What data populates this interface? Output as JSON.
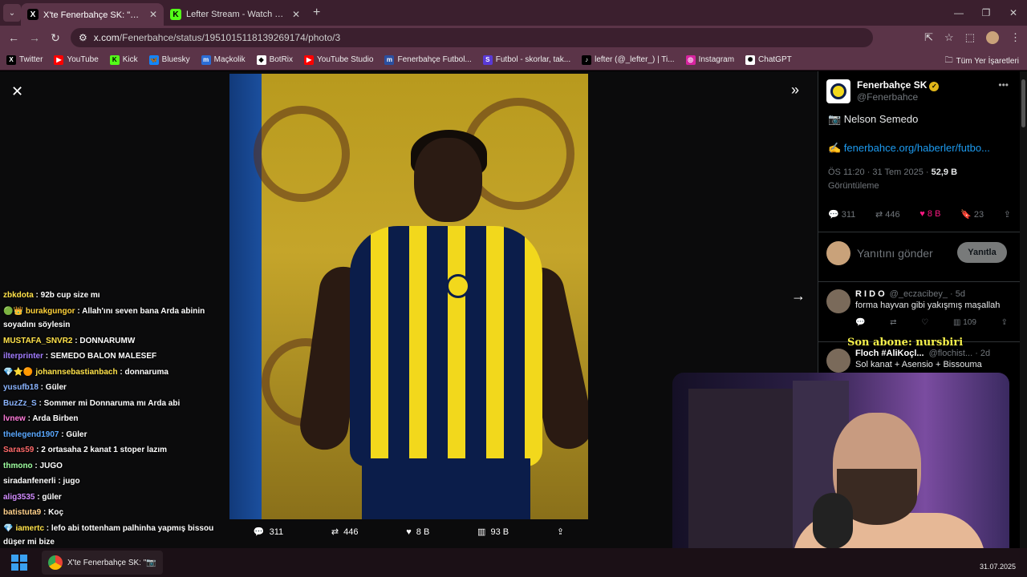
{
  "browser": {
    "tabs": [
      {
        "label": "X'te Fenerbahçe SK: \"📷 Nelson",
        "favicon": "x-logo-icon",
        "active": true
      },
      {
        "label": "Lefter Stream - Watch Live on K",
        "favicon": "kick-logo-icon",
        "active": false
      }
    ],
    "url_host": "x.com",
    "url_path": "/Fenerbahce/status/1951015118139269174/photo/3",
    "bookmarks": [
      {
        "label": "Twitter",
        "icon": "x-logo-icon"
      },
      {
        "label": "YouTube",
        "icon": "youtube-icon"
      },
      {
        "label": "Kick",
        "icon": "kick-logo-icon"
      },
      {
        "label": "Bluesky",
        "icon": "bluesky-icon"
      },
      {
        "label": "Maçkolik",
        "icon": "mackolik-icon"
      },
      {
        "label": "BotRix",
        "icon": "botrix-icon"
      },
      {
        "label": "YouTube Studio",
        "icon": "youtube-icon"
      },
      {
        "label": "Fenerbahçe Futbol...",
        "icon": "fenerbahce-icon"
      },
      {
        "label": "Futbol - skorlar, tak...",
        "icon": "futbol-icon"
      },
      {
        "label": "lefter (@_lefter_) | Ti...",
        "icon": "tiktok-icon"
      },
      {
        "label": "Instagram",
        "icon": "instagram-icon"
      },
      {
        "label": "ChatGPT",
        "icon": "chatgpt-icon"
      }
    ],
    "all_bookmarks": "Tüm Yer İşaretleri"
  },
  "photo_actions": {
    "replies": "311",
    "reposts": "446",
    "likes": "8 B",
    "views": "93 B"
  },
  "tweet": {
    "author_name": "Fenerbahçe SK",
    "author_handle": "@Fenerbahce",
    "text": "📷 Nelson Semedo",
    "link": "✍️ fenerbahce.org/haberler/futbo...",
    "time": "ÖS 11:20 · 31 Tem 2025 · ",
    "views": "52,9 B",
    "views_label": "Görüntüleme",
    "replies": "311",
    "reposts": "446",
    "likes": "8 B",
    "bookmarks": "23",
    "reply_placeholder": "Yanıtını gönder",
    "reply_button": "Yanıtla"
  },
  "replies": [
    {
      "name": "R I D O",
      "handle": "@_eczacibey_ · 5d",
      "text": "forma hayvan gibi yakışmış maşallah",
      "views": "109"
    },
    {
      "name": "Floch #AliKoçl...",
      "handle": "@flochist... · 2d",
      "text": "Sol kanat + Asensio + Bissouma"
    }
  ],
  "sub_banner": "Son abone: nursbiri",
  "chat": [
    {
      "user": "zbkdota",
      "color": "#ffe24a",
      "msg": "92b cup size mı"
    },
    {
      "user": "burakgungor",
      "color": "#ffd23a",
      "msg": "Allah'ını seven bana Arda abinin soyadını söylesin",
      "badges": "🟢👑"
    },
    {
      "user": "MUSTAFA_SNVR2",
      "color": "#ffe24a",
      "msg": "DONNARUMW"
    },
    {
      "user": "ilterprinter",
      "color": "#a27cff",
      "msg": "SEMEDO BALON MALESEF"
    },
    {
      "user": "johannsebastianbach",
      "color": "#ffe24a",
      "msg": "donnaruma",
      "badges": "💎⭐🟠"
    },
    {
      "user": "yusufb18",
      "color": "#8ab4ff",
      "msg": "Güler"
    },
    {
      "user": "BuzZz_S",
      "color": "#8ab4ff",
      "msg": "Sommer mi Donnaruma mı Arda abi"
    },
    {
      "user": "lvnew",
      "color": "#ff7ad9",
      "msg": "Arda Birben"
    },
    {
      "user": "thelegend1907",
      "color": "#5aa8ff",
      "msg": "Güler"
    },
    {
      "user": "Saras59",
      "color": "#ff6a6a",
      "msg": "2 ortasaha 2 kanat 1 stoper lazım"
    },
    {
      "user": "thmono",
      "color": "#9effa0",
      "msg": "JUGO"
    },
    {
      "user": "siradanfenerli",
      "color": "#ffffff",
      "msg": "jugo"
    },
    {
      "user": "alig3535",
      "color": "#d28cff",
      "msg": "güler"
    },
    {
      "user": "batistuta9",
      "color": "#ffd08a",
      "msg": "Koç"
    },
    {
      "user": "iamertc",
      "color": "#ffe24a",
      "msg": "lefo abi tottenham palhinha yapmış bissou düşer mi bize",
      "badges": "💎"
    }
  ],
  "taskbar": {
    "app_label": "X'te Fenerbahçe SK: \"📷",
    "date": "31.07.2025"
  }
}
